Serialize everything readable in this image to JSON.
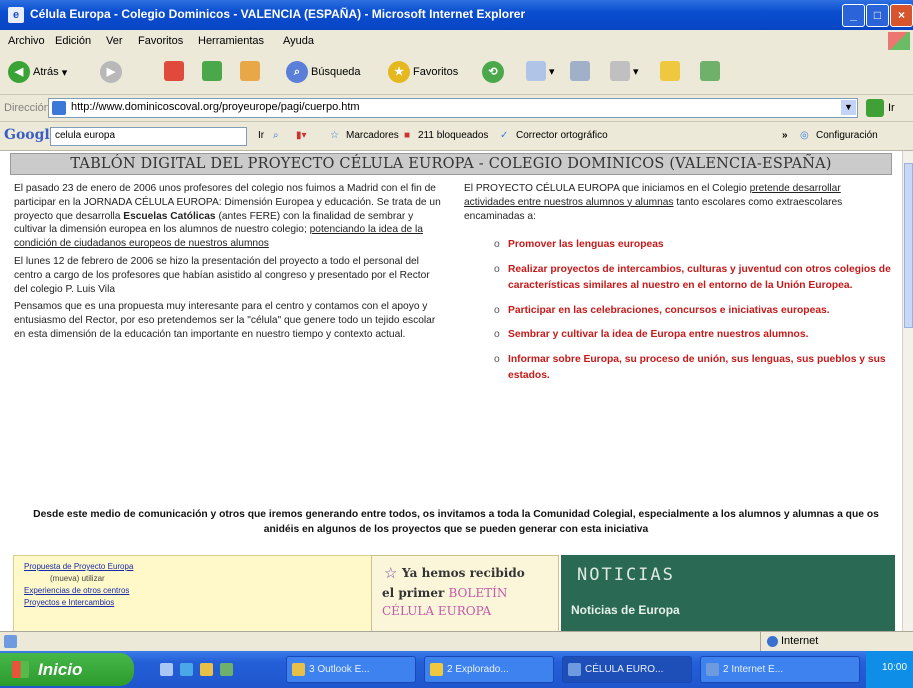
{
  "window": {
    "title": "Célula Europa - Colegio Dominicos - VALENCIA (ESPAÑA) - Microsoft Internet Explorer",
    "controls": {
      "minimize": "_",
      "maximize": "□",
      "close": "×"
    }
  },
  "menu": [
    "Archivo",
    "Edición",
    "Ver",
    "Favoritos",
    "Herramientas",
    "Ayuda"
  ],
  "toolbar": {
    "back_label": "Atrás",
    "search_label": "Búsqueda",
    "favorites_label": "Favoritos"
  },
  "address": {
    "label": "Dirección",
    "url": "http://www.dominicoscoval.org/proyeurope/pagi/cuerpo.htm",
    "go_label": "Ir"
  },
  "googlebar": {
    "logo": "Google",
    "search_value": "celula europa",
    "go_label": "Ir",
    "bookmarks_label": "Marcadores",
    "blocked_label": "211 bloqueados",
    "spell_label": "Corrector ortográfico",
    "more_label": "»",
    "settings_label": "Configuración"
  },
  "page": {
    "banner": "TABLÓN DIGITAL DEL PROYECTO CÉLULA EUROPA - COLEGIO DOMINICOS (VALENCIA-ESPAÑA)",
    "left": {
      "p1_a": "El pasado 23 de enero de 2006 unos profesores del colegio nos fuimos a Madrid con el fin de participar en la JORNADA CÉLULA EUROPA: Dimensión Europea y educación. Se trata de un proyecto que desarrolla ",
      "p1_bold": "Escuelas Católicas",
      "p1_b": " (antes FERE) con la finalidad de sembrar y cultivar la dimensión europea en los alumnos de nuestro colegio; ",
      "p1_link": "potenciando la idea de la condición de ciudadanos europeos de nuestros alumnos",
      "p2": "El lunes 12 de febrero de 2006 se hizo la presentación del proyecto a todo el personal del centro a cargo de los profesores que habían asistido al congreso y presentado por el Rector del colegio P. Luis Vila",
      "p3": "Pensamos que es una propuesta muy interesante para el centro y contamos con el apoyo y entusiasmo del Rector, por eso pretendemos ser la \"célula\" que genere todo un tejido escolar en esta dimensión de la educación tan importante en nuestro tiempo y contexto actual."
    },
    "right": {
      "intro_a": "El PROYECTO CÉLULA EUROPA que iniciamos en el Colegio ",
      "intro_link": "pretende desarrollar actividades entre nuestros alumnos y alumnas",
      "intro_b": " tanto escolares como extraescolares encaminadas a:",
      "goals": [
        "Promover las lenguas europeas",
        "Realizar proyectos de intercambios, culturas y juventud con otros colegios de características similares al nuestro en el entorno de la Unión Europea.",
        "Participar en las celebraciones, concursos e iniciativas europeas.",
        "Sembrar y cultivar la idea de Europa entre nuestros alumnos.",
        "Informar sobre Europa, su proceso de unión, sus lenguas, sus pueblos y sus estados."
      ]
    },
    "notice": "Desde este medio de comunicación y otros que iremos generando entre todos, os invitamos a toda la Comunidad Colegial, especialmente a los alumnos y alumnas a que os anidéis en algunos de los proyectos que se pueden generar con esta iniciativa",
    "bottom_left_links": [
      "Propuesta de Proyecto Europa",
      "(mueva) utilizar",
      "Experiencias de otros centros",
      "Proyectos e Intercambios"
    ],
    "bottom_mid": {
      "line1": "Ya hemos recibido",
      "line2_a": "el primer ",
      "line2_b": "BOLETÍN",
      "line3": "CÉLULA EUROPA"
    },
    "bottom_right": {
      "title": "NOTICIAS",
      "subtitle": "Noticias de Europa"
    }
  },
  "status": {
    "zone": "Internet"
  },
  "taskbar": {
    "start": "Inicio",
    "tasks": [
      "3 Outlook E...",
      "2 Explorado...",
      "CÉLULA EURO...",
      "2 Internet E..."
    ],
    "clock": "10:00"
  }
}
